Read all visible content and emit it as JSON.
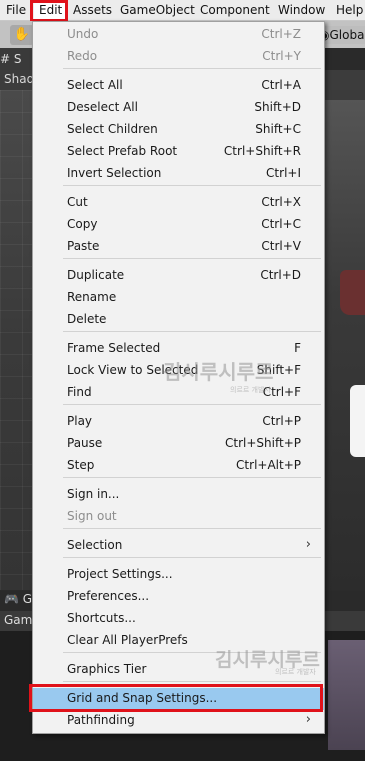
{
  "menubar": {
    "items": [
      "File",
      "Edit",
      "Assets",
      "GameObject",
      "Component",
      "Window",
      "Help"
    ]
  },
  "toolbar": {
    "global_label": "Global"
  },
  "scene": {
    "tab_label": "S",
    "shading_label": "Shad"
  },
  "game": {
    "tab_label": "G",
    "sub_label": "Game"
  },
  "edit_menu": {
    "items": [
      {
        "label": "Undo",
        "shortcut": "Ctrl+Z",
        "disabled": true
      },
      {
        "label": "Redo",
        "shortcut": "Ctrl+Y",
        "disabled": true
      },
      {
        "label": "Select All",
        "shortcut": "Ctrl+A"
      },
      {
        "label": "Deselect All",
        "shortcut": "Shift+D"
      },
      {
        "label": "Select Children",
        "shortcut": "Shift+C"
      },
      {
        "label": "Select Prefab Root",
        "shortcut": "Ctrl+Shift+R"
      },
      {
        "label": "Invert Selection",
        "shortcut": "Ctrl+I"
      },
      {
        "label": "Cut",
        "shortcut": "Ctrl+X"
      },
      {
        "label": "Copy",
        "shortcut": "Ctrl+C"
      },
      {
        "label": "Paste",
        "shortcut": "Ctrl+V"
      },
      {
        "label": "Duplicate",
        "shortcut": "Ctrl+D"
      },
      {
        "label": "Rename",
        "shortcut": ""
      },
      {
        "label": "Delete",
        "shortcut": ""
      },
      {
        "label": "Frame Selected",
        "shortcut": "F"
      },
      {
        "label": "Lock View to Selected",
        "shortcut": "Shift+F"
      },
      {
        "label": "Find",
        "shortcut": "Ctrl+F"
      },
      {
        "label": "Play",
        "shortcut": "Ctrl+P"
      },
      {
        "label": "Pause",
        "shortcut": "Ctrl+Shift+P"
      },
      {
        "label": "Step",
        "shortcut": "Ctrl+Alt+P"
      },
      {
        "label": "Sign in...",
        "shortcut": ""
      },
      {
        "label": "Sign out",
        "shortcut": "",
        "disabled": true
      },
      {
        "label": "Selection",
        "shortcut": "",
        "submenu": true
      },
      {
        "label": "Project Settings...",
        "shortcut": ""
      },
      {
        "label": "Preferences...",
        "shortcut": ""
      },
      {
        "label": "Shortcuts...",
        "shortcut": ""
      },
      {
        "label": "Clear All PlayerPrefs",
        "shortcut": ""
      },
      {
        "label": "Graphics Tier",
        "shortcut": ""
      },
      {
        "label": "Grid and Snap Settings...",
        "shortcut": "",
        "selected": true
      },
      {
        "label": "Pathfinding",
        "shortcut": "",
        "submenu": true
      }
    ],
    "submenu_arrow": "›"
  },
  "watermark": {
    "main": "김시루시루르",
    "sub": "의르르 개발자"
  },
  "colors": {
    "highlight_outline": "#e0121a",
    "selected_row": "#99c9ef",
    "menu_background": "#f2f2f2"
  }
}
